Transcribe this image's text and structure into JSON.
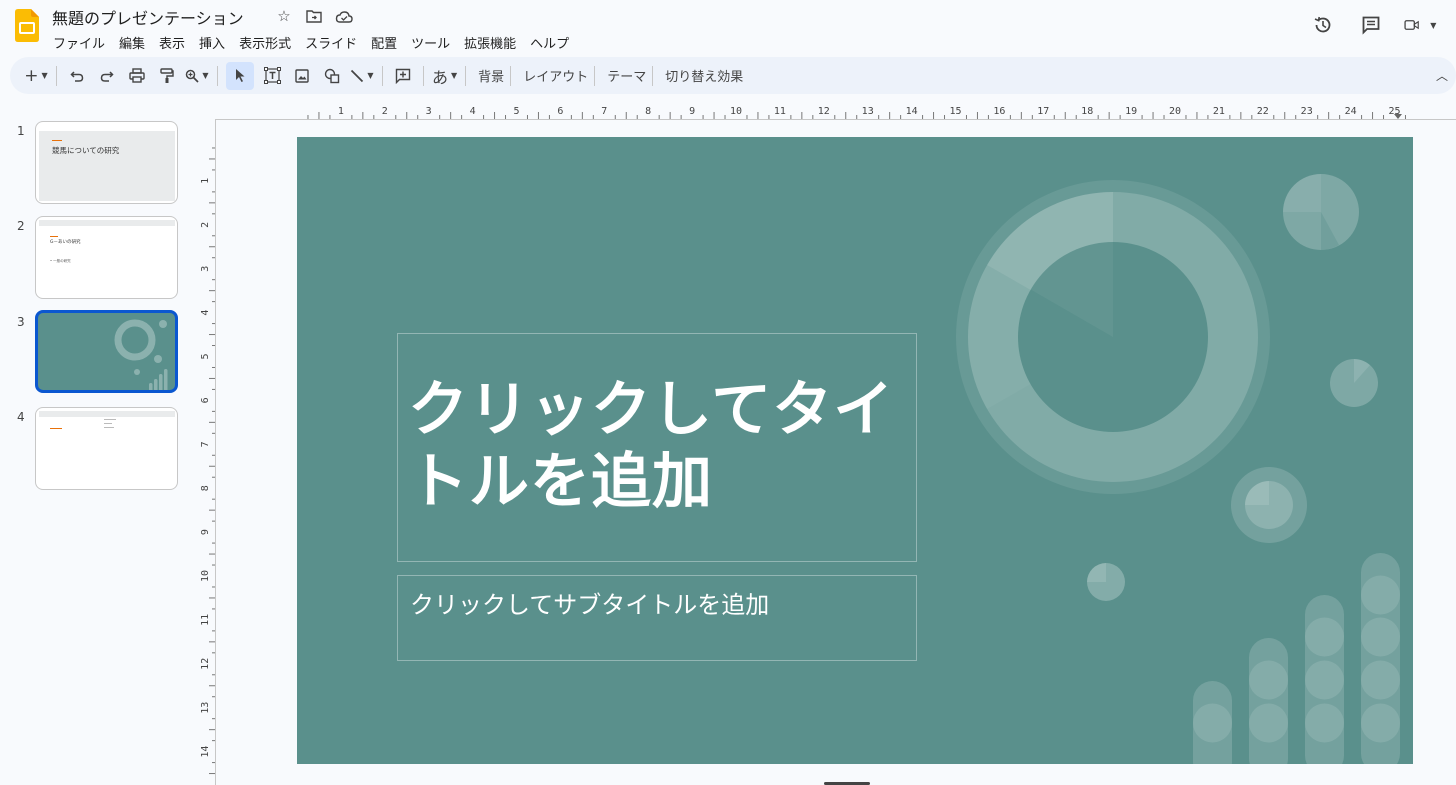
{
  "header": {
    "doc_title": "無題のプレゼンテーション",
    "menu": [
      "ファイル",
      "編集",
      "表示",
      "挿入",
      "表示形式",
      "スライド",
      "配置",
      "ツール",
      "拡張機能",
      "ヘルプ"
    ],
    "brand_color": "#fbbc04"
  },
  "toolbar": {
    "input_tool_label": "あ",
    "background_label": "背景",
    "layout_label": "レイアウト",
    "theme_label": "テーマ",
    "transition_label": "切り替え効果"
  },
  "filmstrip": {
    "slides": [
      {
        "number": "1",
        "title": "競馬についての研究"
      },
      {
        "number": "2",
        "title": "G－あいの研究",
        "body": "• 一般の研究"
      },
      {
        "number": "3"
      },
      {
        "number": "4"
      }
    ],
    "selected": 3,
    "selection_color": "#0b57d0"
  },
  "rulers": {
    "horizontal_labels": [
      "1",
      "2",
      "3",
      "4",
      "5",
      "6",
      "7",
      "8",
      "9",
      "10",
      "11",
      "12",
      "13",
      "14",
      "15",
      "16",
      "17",
      "18",
      "19",
      "20",
      "21",
      "22",
      "23",
      "24",
      "25"
    ],
    "vertical_labels": [
      "1",
      "2",
      "3",
      "4",
      "5",
      "6",
      "7",
      "8",
      "9",
      "10",
      "11",
      "12",
      "13",
      "14"
    ]
  },
  "slide": {
    "background_color": "#5a908c",
    "title_placeholder": "クリックしてタイトルを追加",
    "title_line1": "クリックしてタイ",
    "title_line2": "トルを追加",
    "subtitle_placeholder": "クリックしてサブタイトルを追加"
  }
}
